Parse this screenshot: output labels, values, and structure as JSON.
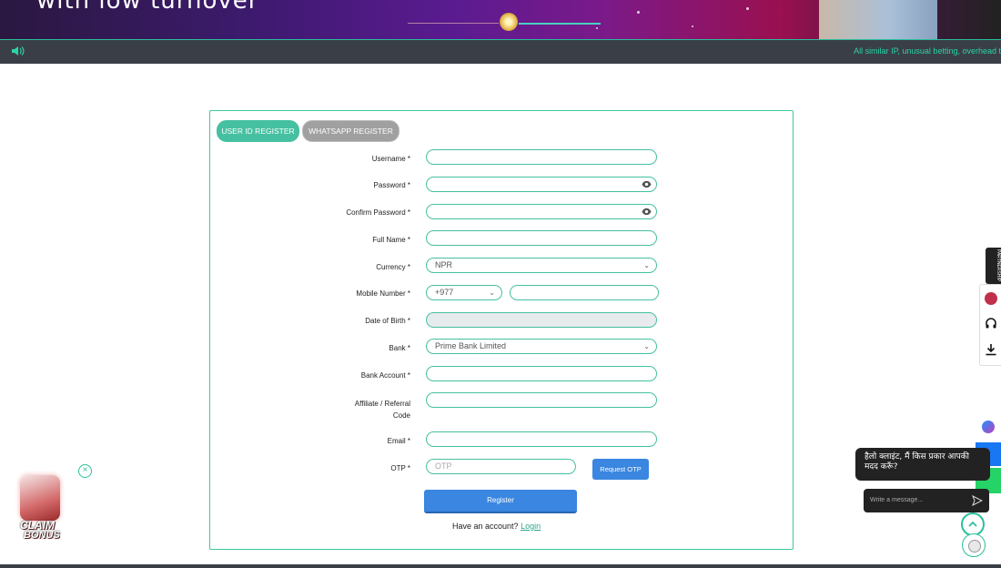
{
  "banner": {
    "headline": "with low turnover"
  },
  "ticker": {
    "message": "All similar IP, unusual betting, overhead t"
  },
  "tabs": {
    "user_id": "USER ID REGISTER",
    "whatsapp": "WHATSAPP REGISTER"
  },
  "form": {
    "username_label": "Username *",
    "password_label": "Password *",
    "confirm_password_label": "Confirm Password *",
    "full_name_label": "Full Name *",
    "currency_label": "Currency *",
    "currency_value": "NPR",
    "mobile_label": "Mobile Number *",
    "mobile_code": "+977",
    "dob_label": "Date of Birth *",
    "bank_label": "Bank *",
    "bank_value": "Prime Bank Limited",
    "bank_account_label": "Bank Account *",
    "affiliate_label_line1": "Affiliate / Referral",
    "affiliate_label_line2": "Code",
    "email_label": "Email *",
    "otp_label": "OTP *",
    "otp_placeholder": "OTP",
    "request_otp": "Request OTP",
    "register": "Register",
    "have_account": "Have an account?",
    "login": "Login"
  },
  "side": {
    "tag": "PARTNERSHIP"
  },
  "chat": {
    "greeting": "हैलो क्लाइंट, मैं किस प्रकार आपकी मदद करूँ?",
    "placeholder": "Write a message..."
  },
  "promo": {
    "line1": "CLAIM",
    "line2": "BONUS"
  },
  "colors": {
    "accent": "#45c0a0",
    "button": "#3a86e0",
    "ticker_bg": "#3a3f47"
  }
}
